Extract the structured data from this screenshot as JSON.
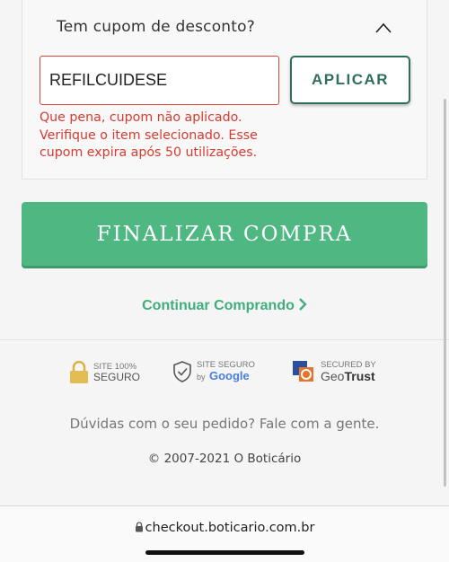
{
  "coupon": {
    "header": "Tem cupom de desconto?",
    "value": "REFILCUIDESE",
    "apply_label": "APLICAR",
    "error_lines": [
      "Que pena, cupom não aplicado.",
      "Verifique o item selecionado. Esse",
      "cupom expira após 50 utilizações."
    ]
  },
  "checkout": {
    "finalize_label": "FINALIZAR COMPRA",
    "continue_label": "Continuar Comprando"
  },
  "seals": {
    "site_secure": {
      "line1": "SITE 100%",
      "line2": "SEGURO"
    },
    "google": {
      "line1": "SITE SEGURO",
      "by": "by",
      "brand": "Google"
    },
    "geotrust": {
      "line1": "SECURED BY",
      "brand_geo": "Geo",
      "brand_trust": "Trust"
    }
  },
  "footer": {
    "help": "Dúvidas com o seu pedido? Fale com a gente.",
    "copyright": "© 2007-2021 O Boticário"
  },
  "browser": {
    "url": "checkout.boticario.com.br"
  },
  "colors": {
    "primary_green": "#4fb882",
    "dark_green": "#2f6e5c",
    "error_red": "#d63b30"
  },
  "icons": {
    "collapse": "chevron-up-icon",
    "continue": "chevron-right-icon",
    "padlock": "lock-icon",
    "shield": "shield-check-icon",
    "geotrust": "geotrust-logo-icon"
  }
}
